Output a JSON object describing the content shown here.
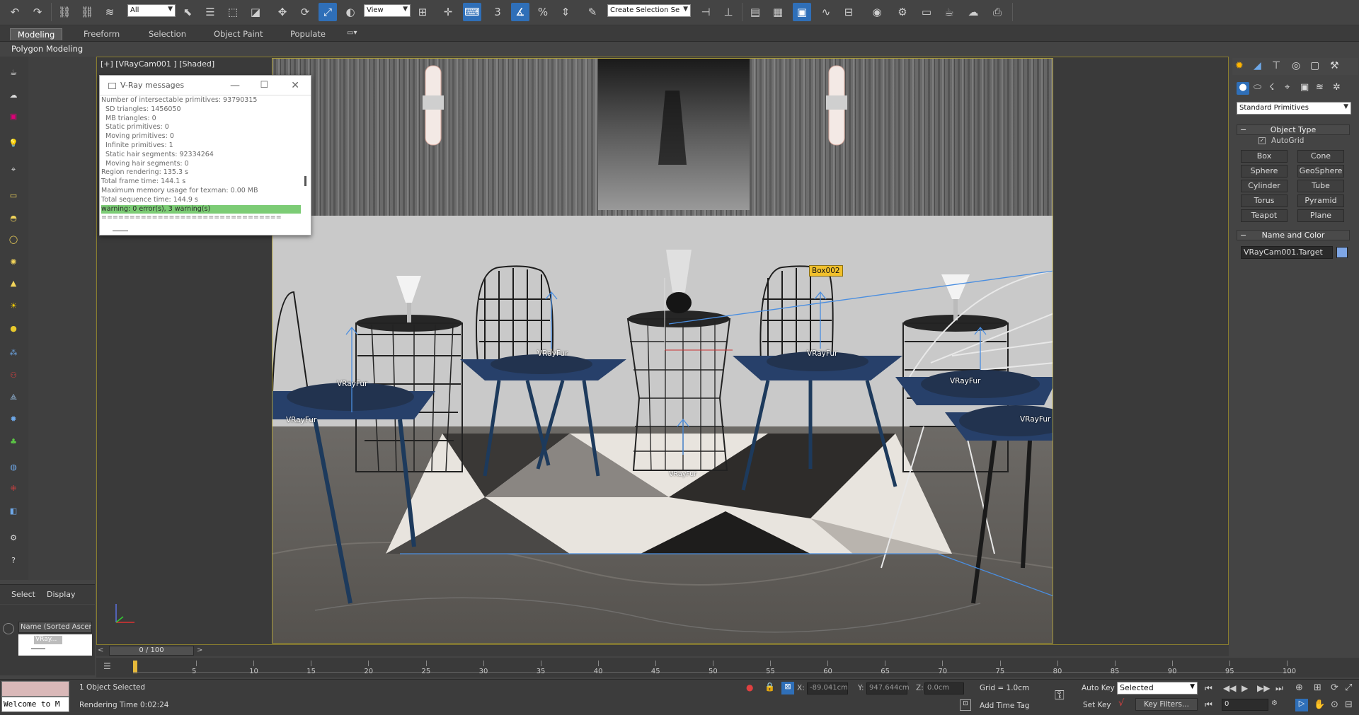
{
  "toolbar": {
    "selection_filter": "All",
    "ref_coord": "View",
    "selection_set_placeholder": "Create Selection Se",
    "snap_3": "3",
    "snap_percent": "%"
  },
  "ribbon": {
    "tabs": [
      "Modeling",
      "Freeform",
      "Selection",
      "Object Paint",
      "Populate"
    ],
    "sub_label": "Polygon Modeling"
  },
  "viewport": {
    "label": "[+] [VRayCam001 ] [Shaded]",
    "scene_labels": [
      {
        "text": "VRayFur"
      },
      {
        "text": "VRayFur"
      },
      {
        "text": "VRayFur"
      },
      {
        "text": "VRayFur"
      },
      {
        "text": "VRayFur"
      },
      {
        "text": "VRayFur"
      },
      {
        "text": "VRayFur"
      }
    ],
    "box_tag": "Box002"
  },
  "vray_window": {
    "title": "V-Ray messages",
    "lines": [
      "Number of intersectable primitives: 93790315",
      "  SD triangles: 1456050",
      "  MB triangles: 0",
      "  Static primitives: 0",
      "  Moving primitives: 0",
      "  Infinite primitives: 1",
      "  Static hair segments: 92334264",
      "  Moving hair segments: 0",
      "Region rendering: 135.3 s",
      "Total frame time: 144.1 s",
      "Maximum memory usage for texman: 0.00 MB",
      "Total sequence time: 144.9 s"
    ],
    "warning_line": "warning: 0 error(s), 3 warning(s)",
    "separator": "================================"
  },
  "scene_explorer": {
    "tabs": [
      "Select",
      "Display"
    ],
    "column_header": "Name (Sorted Ascen",
    "item": "VRay..."
  },
  "command_panel": {
    "category_dropdown": "Standard Primitives",
    "object_type_header": "Object Type",
    "autogrid_label": "AutoGrid",
    "buttons": [
      "Box",
      "Cone",
      "Sphere",
      "GeoSphere",
      "Cylinder",
      "Tube",
      "Torus",
      "Pyramid",
      "Teapot",
      "Plane"
    ],
    "name_color_header": "Name and Color",
    "object_name": "VRayCam001.Target",
    "object_color": "#7ea6e6"
  },
  "timeline": {
    "frame_display": "0 / 100",
    "ticks": [
      "5",
      "10",
      "15",
      "20",
      "25",
      "30",
      "35",
      "40",
      "45",
      "50",
      "55",
      "60",
      "65",
      "70",
      "75",
      "80",
      "85",
      "90",
      "95",
      "100"
    ]
  },
  "status": {
    "maxscript_listener": "Welcome to M",
    "selection_info": "1 Object Selected",
    "render_time": "Rendering Time  0:02:24",
    "x_label": "X:",
    "x_value": "-89.041cm",
    "y_label": "Y:",
    "y_value": "947.644cm",
    "z_label": "Z:",
    "z_value": "0.0cm",
    "grid": "Grid = 1.0cm",
    "add_time_tag": "Add Time Tag",
    "auto_key": "Auto Key",
    "set_key": "Set Key",
    "key_mode": "Selected",
    "key_filters": "Key Filters...",
    "frame_field": "0"
  }
}
